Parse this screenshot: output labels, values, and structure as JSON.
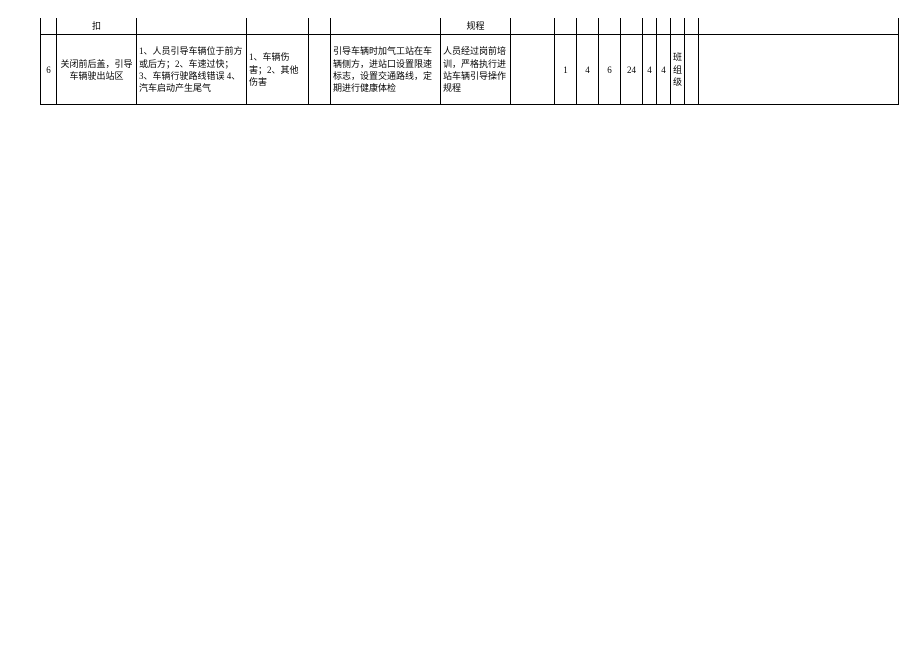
{
  "row1": {
    "c1": "",
    "c2": "扣",
    "c3": "",
    "c4": "",
    "c5": "",
    "c6": "",
    "c7": "规程",
    "c8": "",
    "c9": "",
    "c10": "",
    "c11": "",
    "c12": "",
    "c13": "",
    "c14": "",
    "c15": "",
    "c16": "",
    "c17": ""
  },
  "row2": {
    "c1": "6",
    "c2": "关闭前后盖，引导车辆驶出站区",
    "c3": "1、人员引导车辆位于前方或后方；2、车速过快；3、车辆行驶路线错误 4、汽车启动产生尾气",
    "c4": "1、车辆伤害；2、其他伤害",
    "c5": "",
    "c6": "引导车辆时加气工站在车辆侧方，进站口设置限速标志，设置交通路线，定期进行健康体检",
    "c7": "人员经过岗前培训，严格执行进站车辆引导操作规程",
    "c8": "",
    "c9": "1",
    "c10": "4",
    "c11": "6",
    "c12": "24",
    "c13": "4",
    "c14": "4",
    "c15": "班组级",
    "c16": "",
    "c17": ""
  }
}
